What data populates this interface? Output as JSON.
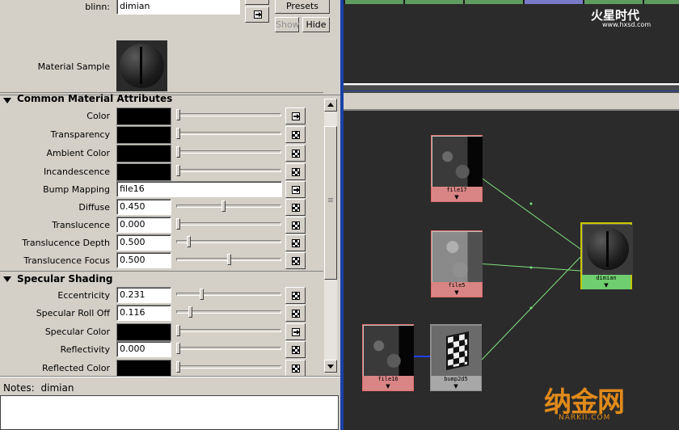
{
  "header": {
    "material_label": "blinn:",
    "material_name": "dimian",
    "presets_label": "Presets",
    "show_label": "Show",
    "hide_label": "Hide",
    "material_sample_label": "Material Sample"
  },
  "sections": {
    "common_title": "Common Material Attributes",
    "specular_title": "Specular Shading"
  },
  "attrs": {
    "color": "Color",
    "transparency": "Transparency",
    "ambient_color": "Ambient Color",
    "incandescence": "Incandescence",
    "bump_mapping": "Bump Mapping",
    "bump_mapping_value": "file16",
    "diffuse": "Diffuse",
    "diffuse_value": "0.450",
    "translucence": "Translucence",
    "translucence_value": "0.000",
    "translucence_depth": "Translucence Depth",
    "translucence_depth_value": "0.500",
    "translucence_focus": "Translucence Focus",
    "translucence_focus_value": "0.500",
    "eccentricity": "Eccentricity",
    "eccentricity_value": "0.231",
    "specular_roll_off": "Specular Roll Off",
    "specular_roll_off_value": "0.116",
    "specular_color": "Specular Color",
    "reflectivity": "Reflectivity",
    "reflectivity_value": "0.000",
    "reflected_color": "Reflected Color"
  },
  "slider_levels": {
    "diffuse": 0.45,
    "translucence": 0.0,
    "translucence_depth": 0.1,
    "translucence_focus": 0.5,
    "eccentricity": 0.231,
    "specular_roll_off": 0.116,
    "reflectivity": 0.0
  },
  "notes": {
    "label": "Notes:",
    "value": "dimian"
  },
  "hypershade": {
    "nodes": {
      "file17": "file17",
      "file5": "file5",
      "file16": "file16",
      "bump2d5": "bump2d5",
      "dimian": "dimian"
    },
    "arrow_glyph": "▼"
  },
  "watermarks": {
    "top_logo": "火星时代",
    "top_url": "www.hxsd.com",
    "bottom_logo": "纳金网",
    "bottom_url": "NARKII.COM"
  },
  "colors": {
    "editor_bg": "#d4d0c8",
    "hypershade_bg": "#2b2b2b",
    "file_node": "#d98585",
    "material_node": "#6fce6f",
    "connection_line": "#7fe07f",
    "panel_divider": "#1c3fa8"
  }
}
